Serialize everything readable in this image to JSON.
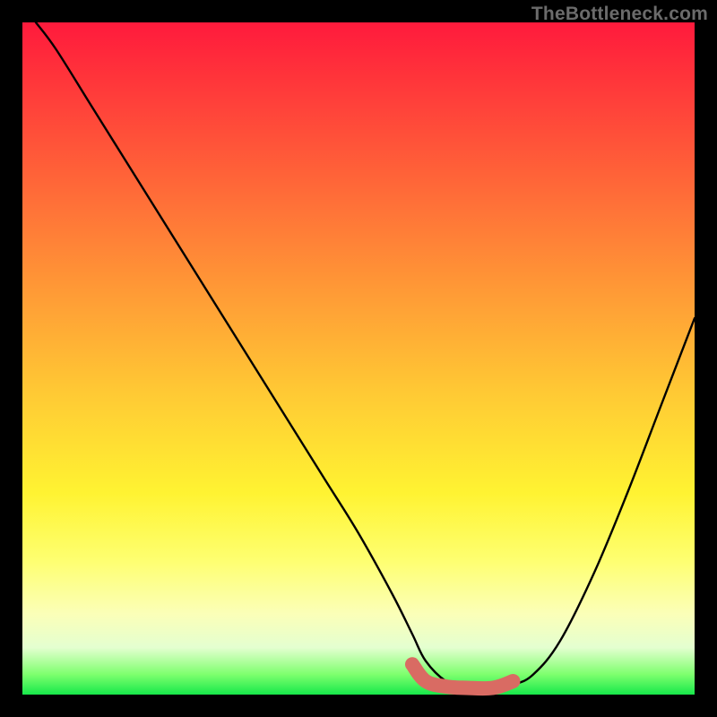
{
  "watermark": "TheBottleneck.com",
  "colors": {
    "curve": "#000000",
    "highlight": "#d96b63",
    "frame": "#000000"
  },
  "chart_data": {
    "type": "line",
    "title": "",
    "xlabel": "",
    "ylabel": "",
    "xlim": [
      0,
      100
    ],
    "ylim": [
      0,
      100
    ],
    "grid": false,
    "series": [
      {
        "name": "bottleneck_curve",
        "x": [
          2,
          5,
          10,
          15,
          20,
          25,
          30,
          35,
          40,
          45,
          50,
          55,
          58,
          60,
          63,
          66,
          70,
          73,
          76,
          80,
          85,
          90,
          95,
          100
        ],
        "y": [
          100,
          96,
          88,
          80,
          72,
          64,
          56,
          48,
          40,
          32,
          24,
          15,
          9,
          5,
          2,
          1,
          1,
          1.5,
          3,
          8,
          18,
          30,
          43,
          56
        ]
      }
    ],
    "highlight_range": {
      "name": "optimal_zone",
      "x": [
        58,
        60,
        63,
        66,
        70,
        73
      ],
      "y": [
        4.5,
        2.0,
        1.2,
        1.0,
        1.0,
        2.0
      ]
    },
    "gradient_stops": [
      {
        "pos": 0.0,
        "color": "#ff1a3c"
      },
      {
        "pos": 0.1,
        "color": "#ff3a3a"
      },
      {
        "pos": 0.25,
        "color": "#ff6a38"
      },
      {
        "pos": 0.4,
        "color": "#ff9a36"
      },
      {
        "pos": 0.55,
        "color": "#ffc934"
      },
      {
        "pos": 0.7,
        "color": "#fff332"
      },
      {
        "pos": 0.8,
        "color": "#feff70"
      },
      {
        "pos": 0.88,
        "color": "#fbffb8"
      },
      {
        "pos": 0.93,
        "color": "#e4ffd0"
      },
      {
        "pos": 0.97,
        "color": "#7eff6e"
      },
      {
        "pos": 1.0,
        "color": "#17e84a"
      }
    ]
  }
}
